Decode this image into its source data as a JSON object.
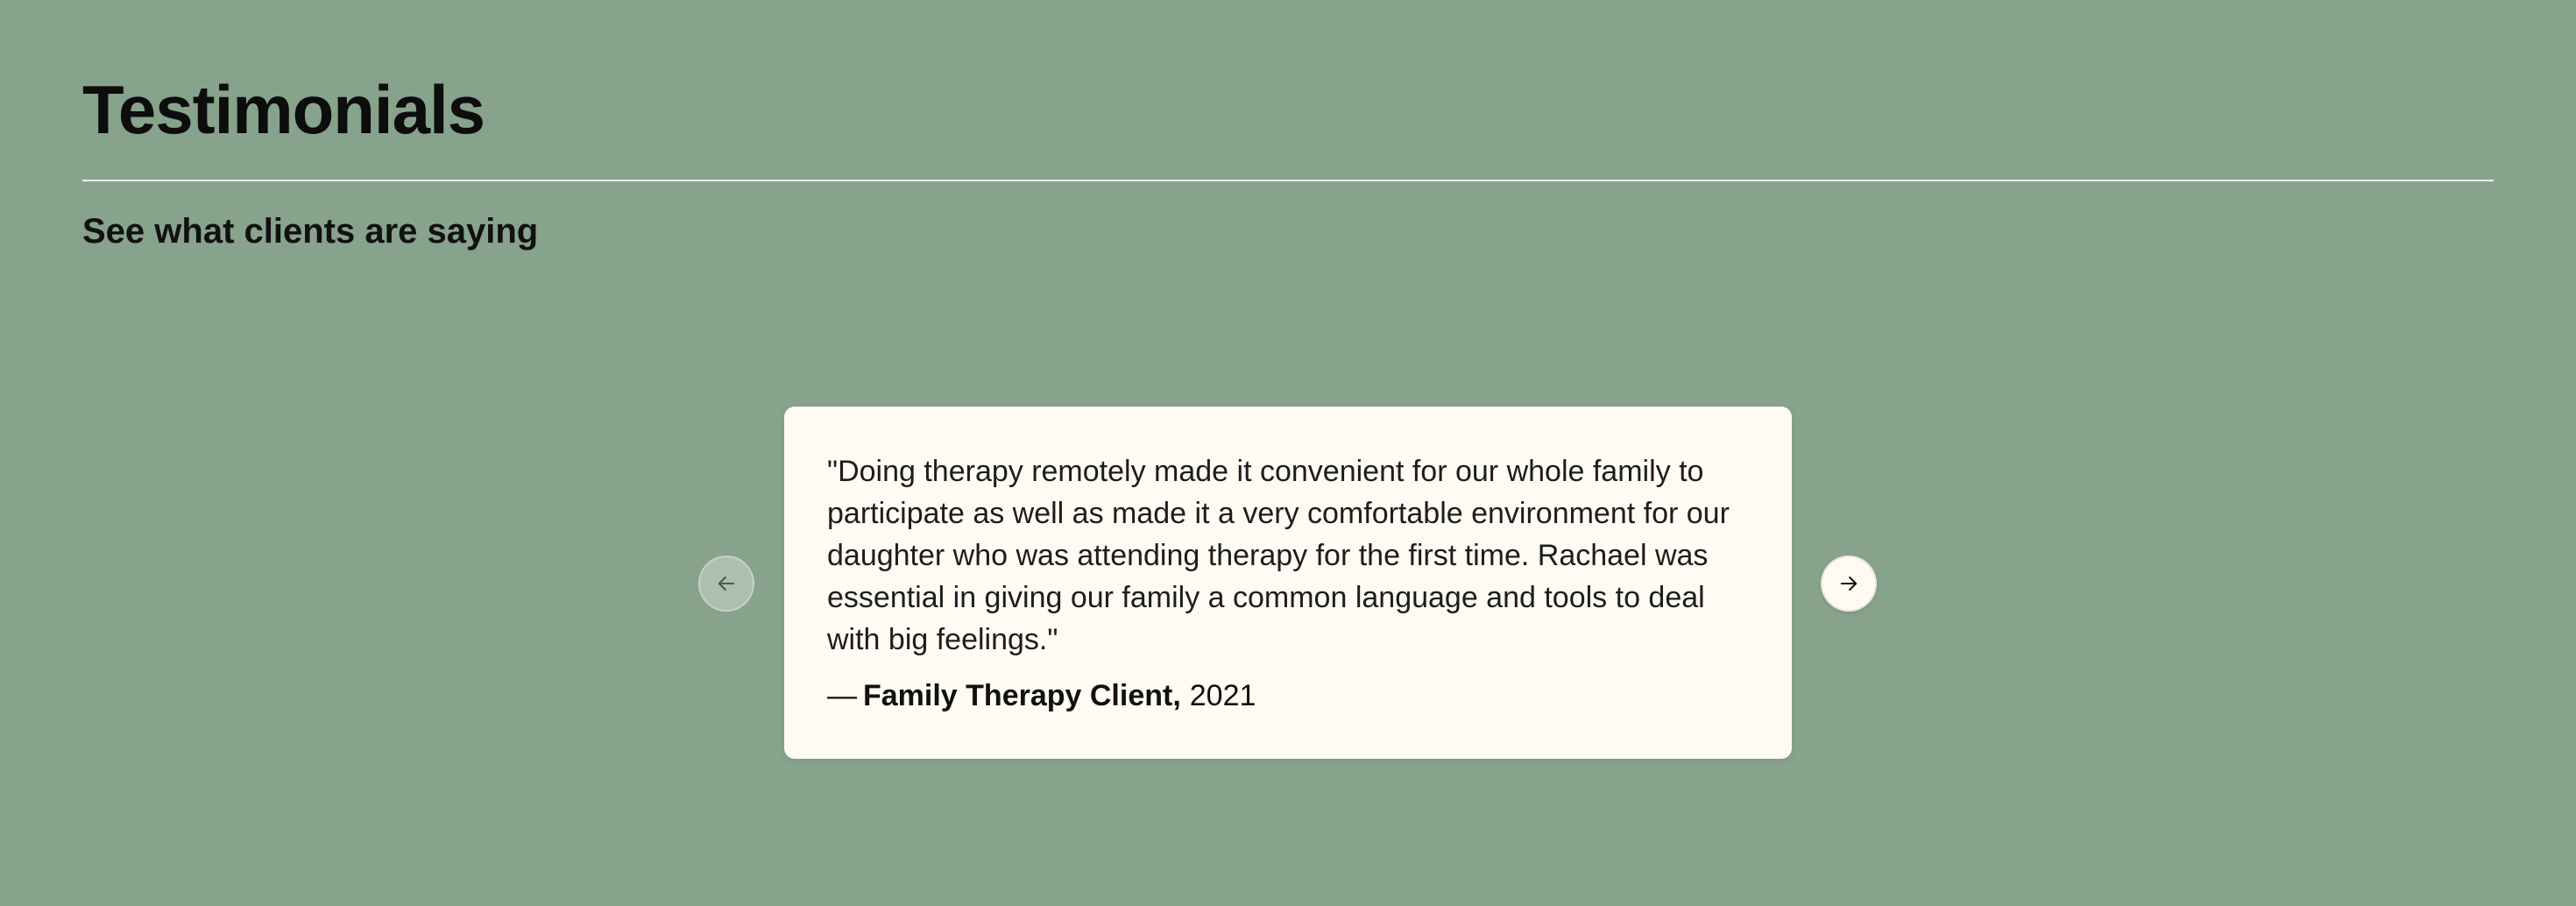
{
  "section": {
    "title": "Testimonials",
    "subtitle": "See what clients are saying"
  },
  "carousel": {
    "prev_icon": "arrow-left-icon",
    "next_icon": "arrow-right-icon"
  },
  "testimonial": {
    "quote": "\"Doing therapy remotely made it convenient for our whole family to participate as well as made it a very comfortable environment for our daughter who was attending therapy for the first time. Rachael was essential in giving our family a common language and tools to deal with big feelings.\"",
    "attribution_prefix": "—",
    "client_name": "Family Therapy Client,",
    "year": "2021"
  },
  "colors": {
    "background": "#87a38b",
    "card": "#fffbf3",
    "text": "#111111",
    "divider": "#ffffff"
  }
}
